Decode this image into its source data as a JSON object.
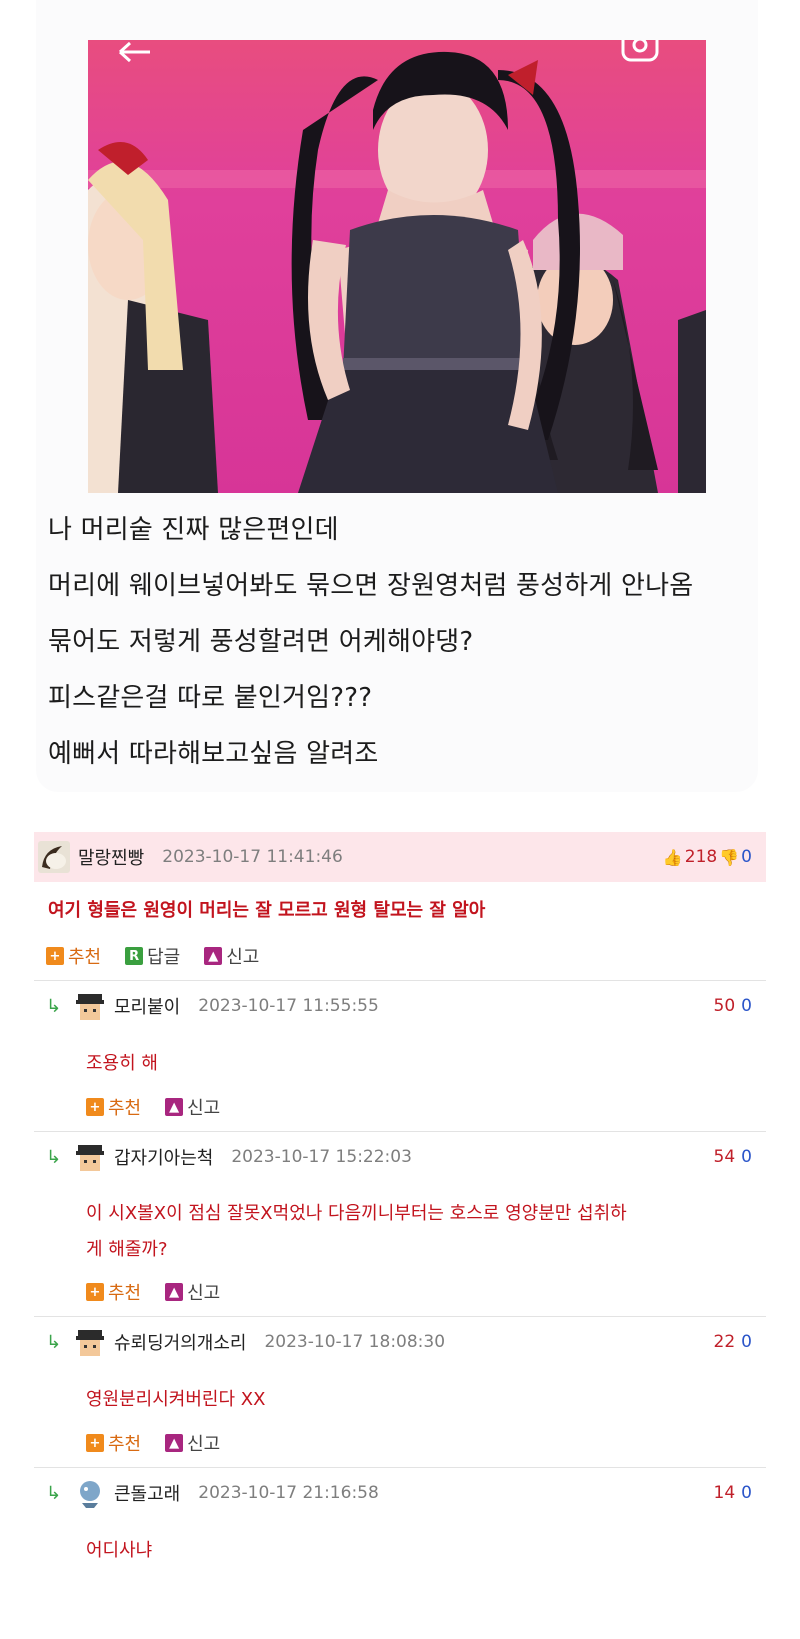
{
  "post": {
    "lines": [
      "나 머리숱 진짜 많은편인데",
      "머리에 웨이브넣어봐도 묶으면 장원영처럼 풍성하게 안나옴",
      "묶어도 저렇게 풍성할려면 어케해야댕?",
      "피스같은걸 따로 붙인거임???",
      "예뻐서 따라해보고싶음 알려조"
    ]
  },
  "best_comment": {
    "nick": "말랑찐빵",
    "date": "2023-10-17 11:41:46",
    "up": "218",
    "down": "0",
    "text": "여기 형들은 원영이 머리는 잘 모르고 원형 탈모는 잘 알아",
    "actions": {
      "recommend": "추천",
      "reply": "답글",
      "report": "신고"
    }
  },
  "replies": [
    {
      "nick": "모리붙이",
      "date": "2023-10-17 11:55:55",
      "up": "50",
      "down": "0",
      "text_lines": [
        "조용히 해"
      ],
      "actions": {
        "recommend": "추천",
        "report": "신고"
      }
    },
    {
      "nick": "갑자기아는척",
      "date": "2023-10-17 15:22:03",
      "up": "54",
      "down": "0",
      "text_lines": [
        "이 시X볼X이 점심 잘못X먹었나 다음끼니부터는 호스로 영양분만 섭취하",
        "게 해줄까?"
      ],
      "actions": {
        "recommend": "추천",
        "report": "신고"
      }
    },
    {
      "nick": "슈뢰딩거의개소리",
      "date": "2023-10-17 18:08:30",
      "up": "22",
      "down": "0",
      "text_lines": [
        "영원분리시켜버린다 XX"
      ],
      "actions": {
        "recommend": "추천",
        "report": "신고"
      }
    },
    {
      "nick": "큰돌고래",
      "date": "2023-10-17 21:16:58",
      "up": "14",
      "down": "0",
      "text_lines": [
        "어디사냐"
      ],
      "actions": {
        "recommend": "추천",
        "report": "신고"
      }
    }
  ],
  "colors": {
    "best_bg": "#fde6ea",
    "comment_text": "#c2141e",
    "upvote": "#c0202a",
    "downvote": "#2b55c9",
    "reply_arrow": "#3aa44a",
    "photo_bg": "#e23f93"
  },
  "icons": {
    "back": "arrow-left-icon",
    "camera": "instagram-icon",
    "reply_arrow": "reply-arrow-icon",
    "up": "thumbs-up-icon",
    "down": "thumbs-down-icon"
  }
}
